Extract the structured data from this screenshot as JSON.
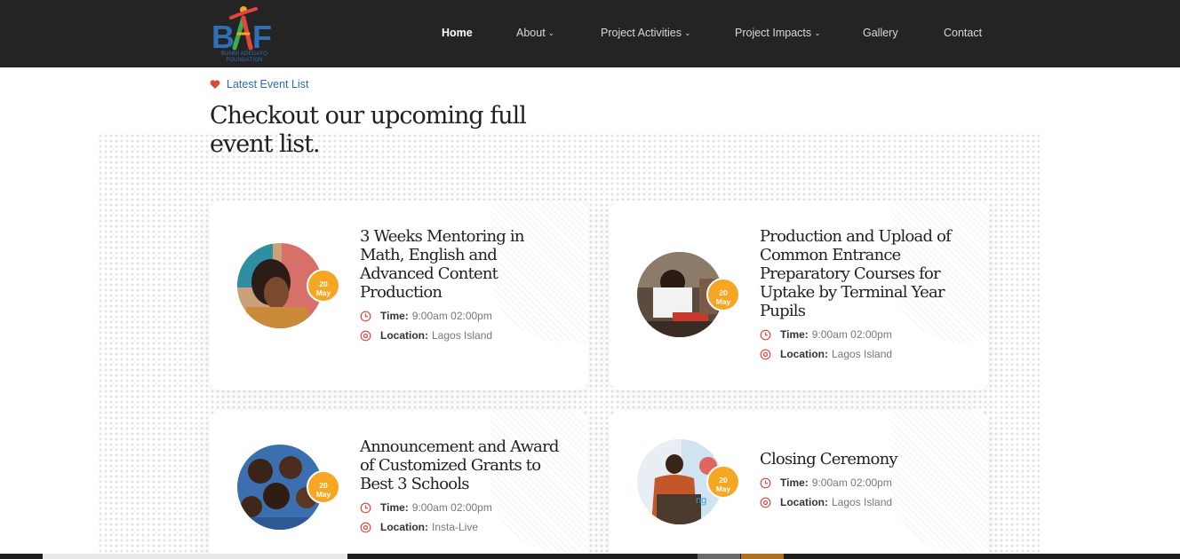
{
  "header": {
    "logo_letters": "BAF",
    "logo_subtext": "BUNMI ADEDAYO FOUNDATION",
    "nav": [
      {
        "label": "Home",
        "active": true,
        "dropdown": false
      },
      {
        "label": "About",
        "active": false,
        "dropdown": true
      },
      {
        "label": "Project Activities",
        "active": false,
        "dropdown": true
      },
      {
        "label": "Project Impacts",
        "active": false,
        "dropdown": true
      },
      {
        "label": "Gallery",
        "active": false,
        "dropdown": false
      },
      {
        "label": "Contact",
        "active": false,
        "dropdown": false
      }
    ]
  },
  "section": {
    "subtitle": "Latest Event List",
    "title": "Checkout our upcoming full event list."
  },
  "events": [
    {
      "title": "3 Weeks Mentoring in Math, English and Advanced Content Production",
      "date_day": "20",
      "date_month": "May",
      "time_label": "Time:",
      "time_value": "9:00am 02:00pm",
      "location_label": "Location:",
      "location_value": "Lagos Island"
    },
    {
      "title": "Production and Upload of Common Entrance Preparatory Courses for Uptake by Terminal Year Pupils",
      "date_day": "20",
      "date_month": "May",
      "time_label": "Time:",
      "time_value": "9:00am 02:00pm",
      "location_label": "Location:",
      "location_value": "Lagos Island"
    },
    {
      "title": "Announcement and Award of Customized Grants to Best 3 Schools",
      "date_day": "20",
      "date_month": "May",
      "time_label": "Time:",
      "time_value": "9:00am 02:00pm",
      "location_label": "Location:",
      "location_value": "Insta-Live"
    },
    {
      "title": "Closing Ceremony",
      "date_day": "20",
      "date_month": "May",
      "time_label": "Time:",
      "time_value": "9:00am 02:00pm",
      "location_label": "Location:",
      "location_value": "Lagos Island"
    }
  ],
  "colors": {
    "header_bg": "#242424",
    "accent_blue": "#2a6bb3",
    "accent_orange": "#f6a623",
    "accent_red": "#e0463c",
    "heading_text": "#1f1f1f"
  },
  "icons": {
    "subtitle": "heart-icon",
    "time": "clock-icon",
    "location": "map-pin-icon"
  }
}
